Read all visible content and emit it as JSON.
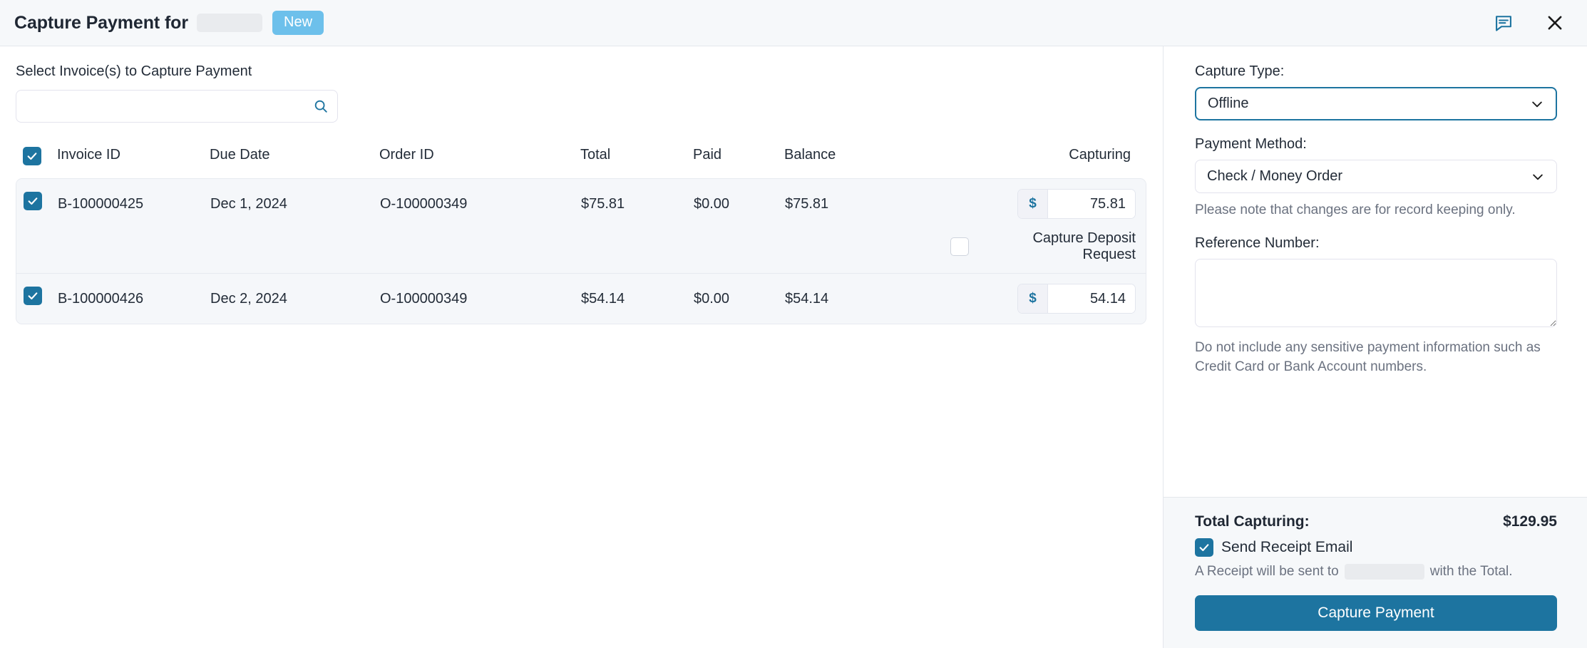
{
  "header": {
    "title": "Capture Payment for",
    "customer_redacted": true,
    "badge_label": "New",
    "badge_color": "#6dc0eb",
    "comment_icon": "comment-icon",
    "close_icon": "close-icon"
  },
  "left": {
    "section_label": "Select Invoice(s) to Capture Payment",
    "search": {
      "value": "",
      "placeholder": "",
      "icon": "search-icon"
    },
    "table": {
      "select_all_checked": true,
      "columns": [
        "Invoice ID",
        "Due Date",
        "Order ID",
        "Total",
        "Paid",
        "Balance",
        "Capturing"
      ],
      "currency_prefix": "$",
      "rows": [
        {
          "selected": true,
          "invoice_id": "B-100000425",
          "due_date": "Dec 1, 2024",
          "order_id": "O-100000349",
          "total": "$75.81",
          "paid": "$0.00",
          "balance": "$75.81",
          "capturing": "75.81",
          "deposit_request": {
            "label": "Capture Deposit Request",
            "checked": false
          }
        },
        {
          "selected": true,
          "invoice_id": "B-100000426",
          "due_date": "Dec 2, 2024",
          "order_id": "O-100000349",
          "total": "$54.14",
          "paid": "$0.00",
          "balance": "$54.14",
          "capturing": "54.14",
          "deposit_request": null
        }
      ]
    }
  },
  "right": {
    "capture_type": {
      "label": "Capture Type:",
      "value": "Offline",
      "focused": true
    },
    "payment_method": {
      "label": "Payment Method:",
      "value": "Check / Money Order",
      "note": "Please note that changes are for record keeping only."
    },
    "reference_number": {
      "label": "Reference Number:",
      "value": "",
      "note": "Do not include any sensitive payment information such as Credit Card or Bank Account numbers."
    },
    "footer": {
      "total_label": "Total Capturing:",
      "total_value": "$129.95",
      "send_receipt_label": "Send Receipt Email",
      "send_receipt_checked": true,
      "receipt_note_prefix": "A Receipt will be sent to",
      "receipt_note_suffix": "with the Total.",
      "submit_label": "Capture Payment"
    }
  },
  "theme": {
    "accent": "#1d74a0",
    "badge": "#6dc0eb",
    "header_bg": "#f6f8fa",
    "row_bg": "#f5f7fa",
    "border": "#e4e7ec",
    "muted_text": "#6b7280"
  }
}
